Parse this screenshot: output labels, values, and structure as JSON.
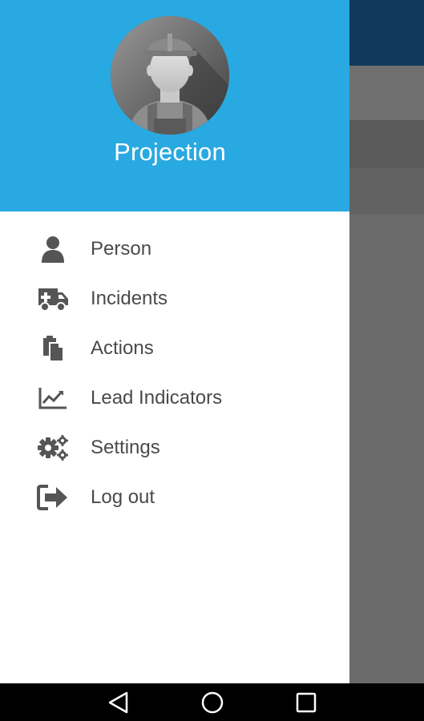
{
  "drawer": {
    "app_name": "Projection",
    "avatar_icon": "worker-avatar-icon",
    "header_color": "#29a9e1",
    "items": [
      {
        "label": "Person",
        "icon": "person-icon"
      },
      {
        "label": "Incidents",
        "icon": "ambulance-icon"
      },
      {
        "label": "Actions",
        "icon": "clipboard-copy-icon"
      },
      {
        "label": "Lead Indicators",
        "icon": "trend-chart-icon"
      },
      {
        "label": "Settings",
        "icon": "gears-icon"
      },
      {
        "label": "Log out",
        "icon": "logout-icon"
      }
    ]
  },
  "background": {
    "topbar_color": "#12395c",
    "overlay": "dimmed"
  },
  "navbar": {
    "buttons": [
      "back",
      "home",
      "recent-apps"
    ]
  }
}
